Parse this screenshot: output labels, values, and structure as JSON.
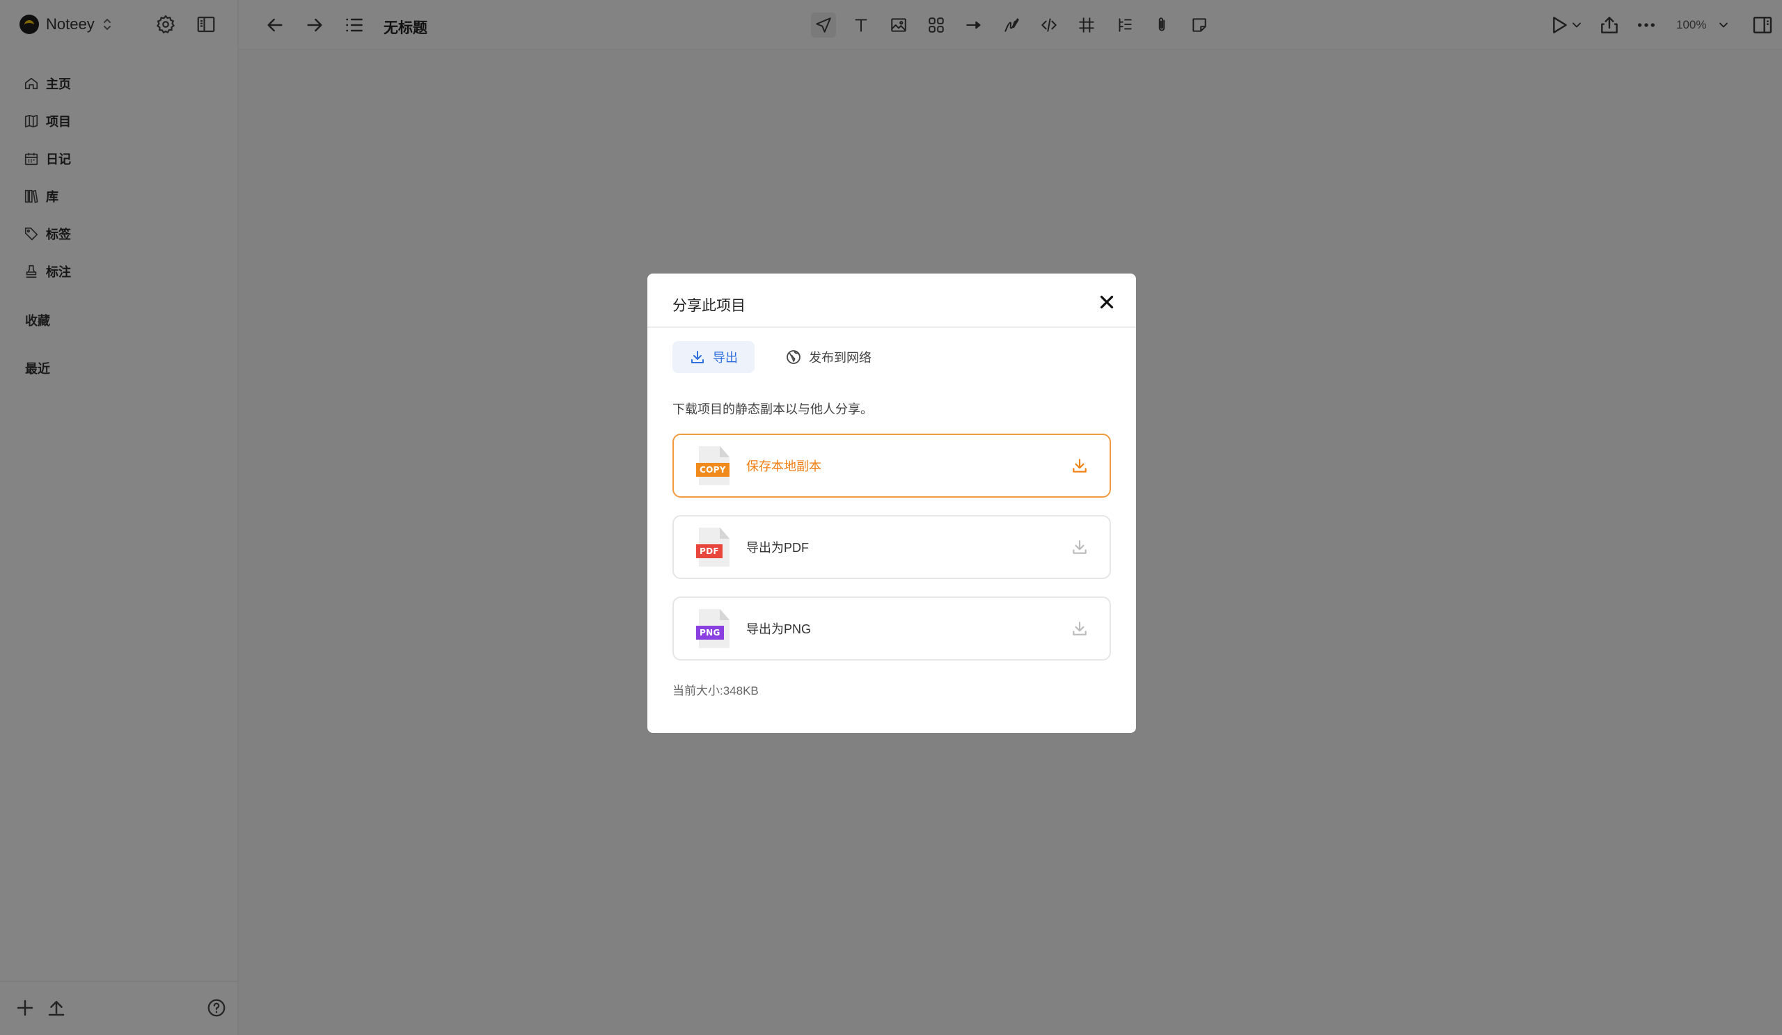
{
  "app": {
    "name": "Noteey"
  },
  "sidebar": {
    "items": [
      {
        "label": "主页",
        "icon": "home-icon"
      },
      {
        "label": "项目",
        "icon": "map-icon"
      },
      {
        "label": "日记",
        "icon": "calendar-icon"
      },
      {
        "label": "库",
        "icon": "library-icon"
      },
      {
        "label": "标签",
        "icon": "tag-icon"
      },
      {
        "label": "标注",
        "icon": "stamp-icon"
      }
    ],
    "sections": {
      "favorites": "收藏",
      "recent": "最近"
    }
  },
  "topbar": {
    "title": "无标题",
    "zoom": "100%",
    "tools": [
      "pointer-icon",
      "text-icon",
      "image-icon",
      "shapes-icon",
      "arrow-icon",
      "pen-icon",
      "code-icon",
      "frame-icon",
      "list-icon",
      "attachment-icon",
      "sticky-note-icon"
    ],
    "active_tool": "pointer-icon"
  },
  "modal": {
    "title": "分享此项目",
    "tabs": [
      {
        "label": "导出",
        "icon": "download-icon",
        "active": true
      },
      {
        "label": "发布到网络",
        "icon": "globe-icon",
        "active": false
      }
    ],
    "description": "下载项目的静态副本以与他人分享。",
    "options": [
      {
        "label": "保存本地副本",
        "badge": "COPY",
        "badge_color": "#f08a1c",
        "selected": true
      },
      {
        "label": "导出为PDF",
        "badge": "PDF",
        "badge_color": "#e8453c",
        "selected": false
      },
      {
        "label": "导出为PNG",
        "badge": "PNG",
        "badge_color": "#8a3fe0",
        "selected": false
      }
    ],
    "size_text": "当前大小:348KB"
  },
  "colors": {
    "accent": "#f07f14",
    "tab_active": "#2f6fde",
    "overlay": "rgba(0,0,0,0.47)"
  }
}
